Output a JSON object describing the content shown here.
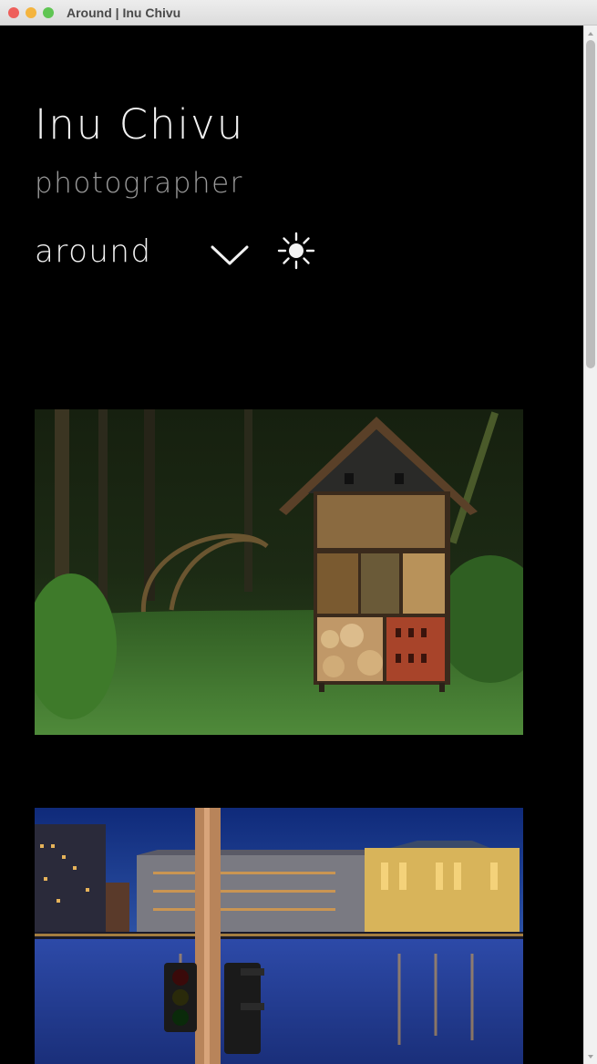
{
  "window": {
    "title": "Around | Inu Chivu"
  },
  "header": {
    "title": "Inu Chivu",
    "subtitle": "photographer",
    "current_section": "around"
  },
  "icons": {
    "nav_toggle": "chevron-down-icon",
    "theme_toggle": "sun-icon"
  },
  "colors": {
    "background": "#000000",
    "title_text": "#f2f2f2",
    "subtitle_text": "#9a9a9a"
  },
  "photos": [
    {
      "subject": "insect-hotel-in-forest"
    },
    {
      "subject": "city-riverfront-at-dusk"
    }
  ]
}
